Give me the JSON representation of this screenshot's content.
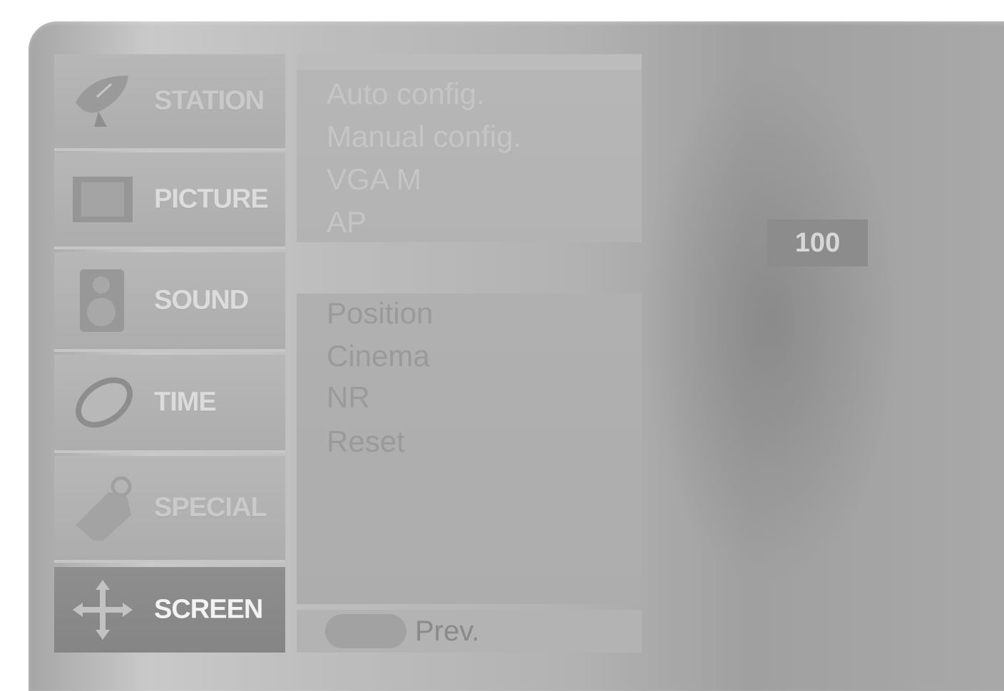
{
  "menu": {
    "items": [
      {
        "label": "STATION",
        "icon": "satellite-dish-icon"
      },
      {
        "label": "PICTURE",
        "icon": "film-frame-icon"
      },
      {
        "label": "SOUND",
        "icon": "speaker-icon"
      },
      {
        "label": "TIME",
        "icon": "clock-icon"
      },
      {
        "label": "SPECIAL",
        "icon": "tag-icon"
      },
      {
        "label": "SCREEN",
        "icon": "move-arrows-icon"
      }
    ],
    "active": "SCREEN"
  },
  "submenu": {
    "group1": [
      "Auto config.",
      "Manual config.",
      "VGA M",
      "AP"
    ],
    "group2": [
      "Position",
      "Cinema",
      "NR",
      "Reset"
    ]
  },
  "footer": {
    "prev_label": "Prev."
  },
  "value_display": "100"
}
